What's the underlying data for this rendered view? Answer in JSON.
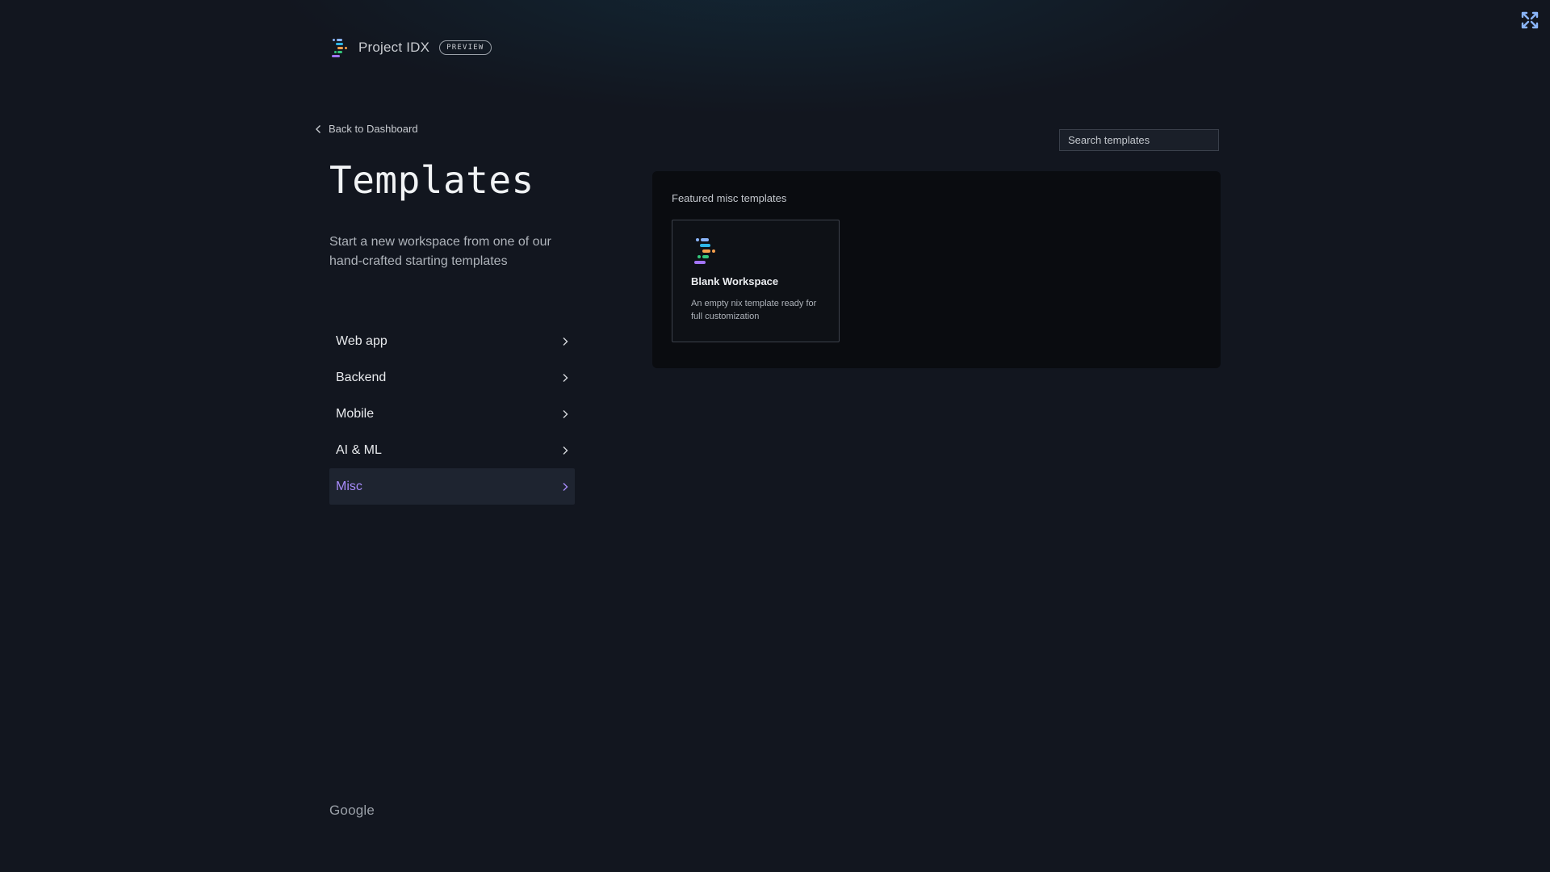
{
  "header": {
    "brand_name": "Project IDX",
    "badge": "PREVIEW",
    "logo_icon": "idx-logo-icon",
    "corner_icon": "cross-arrows-icon"
  },
  "nav": {
    "back_label": "Back to Dashboard"
  },
  "page": {
    "title": "Templates",
    "subtitle": "Start a new workspace from one of our hand-crafted starting templates"
  },
  "categories": [
    {
      "label": "Web app",
      "active": false
    },
    {
      "label": "Backend",
      "active": false
    },
    {
      "label": "Mobile",
      "active": false
    },
    {
      "label": "AI & ML",
      "active": false
    },
    {
      "label": "Misc",
      "active": true
    }
  ],
  "search": {
    "placeholder": "Search templates",
    "value": ""
  },
  "featured": {
    "heading": "Featured misc templates",
    "templates": [
      {
        "title": "Blank Workspace",
        "description": "An empty nix template ready for full customization"
      }
    ]
  },
  "footer": {
    "brand": "Google"
  },
  "colors": {
    "background": "#12161f",
    "panel": "#0a0c10",
    "accent": "#a78bfa",
    "active_row": "#1e2430"
  }
}
